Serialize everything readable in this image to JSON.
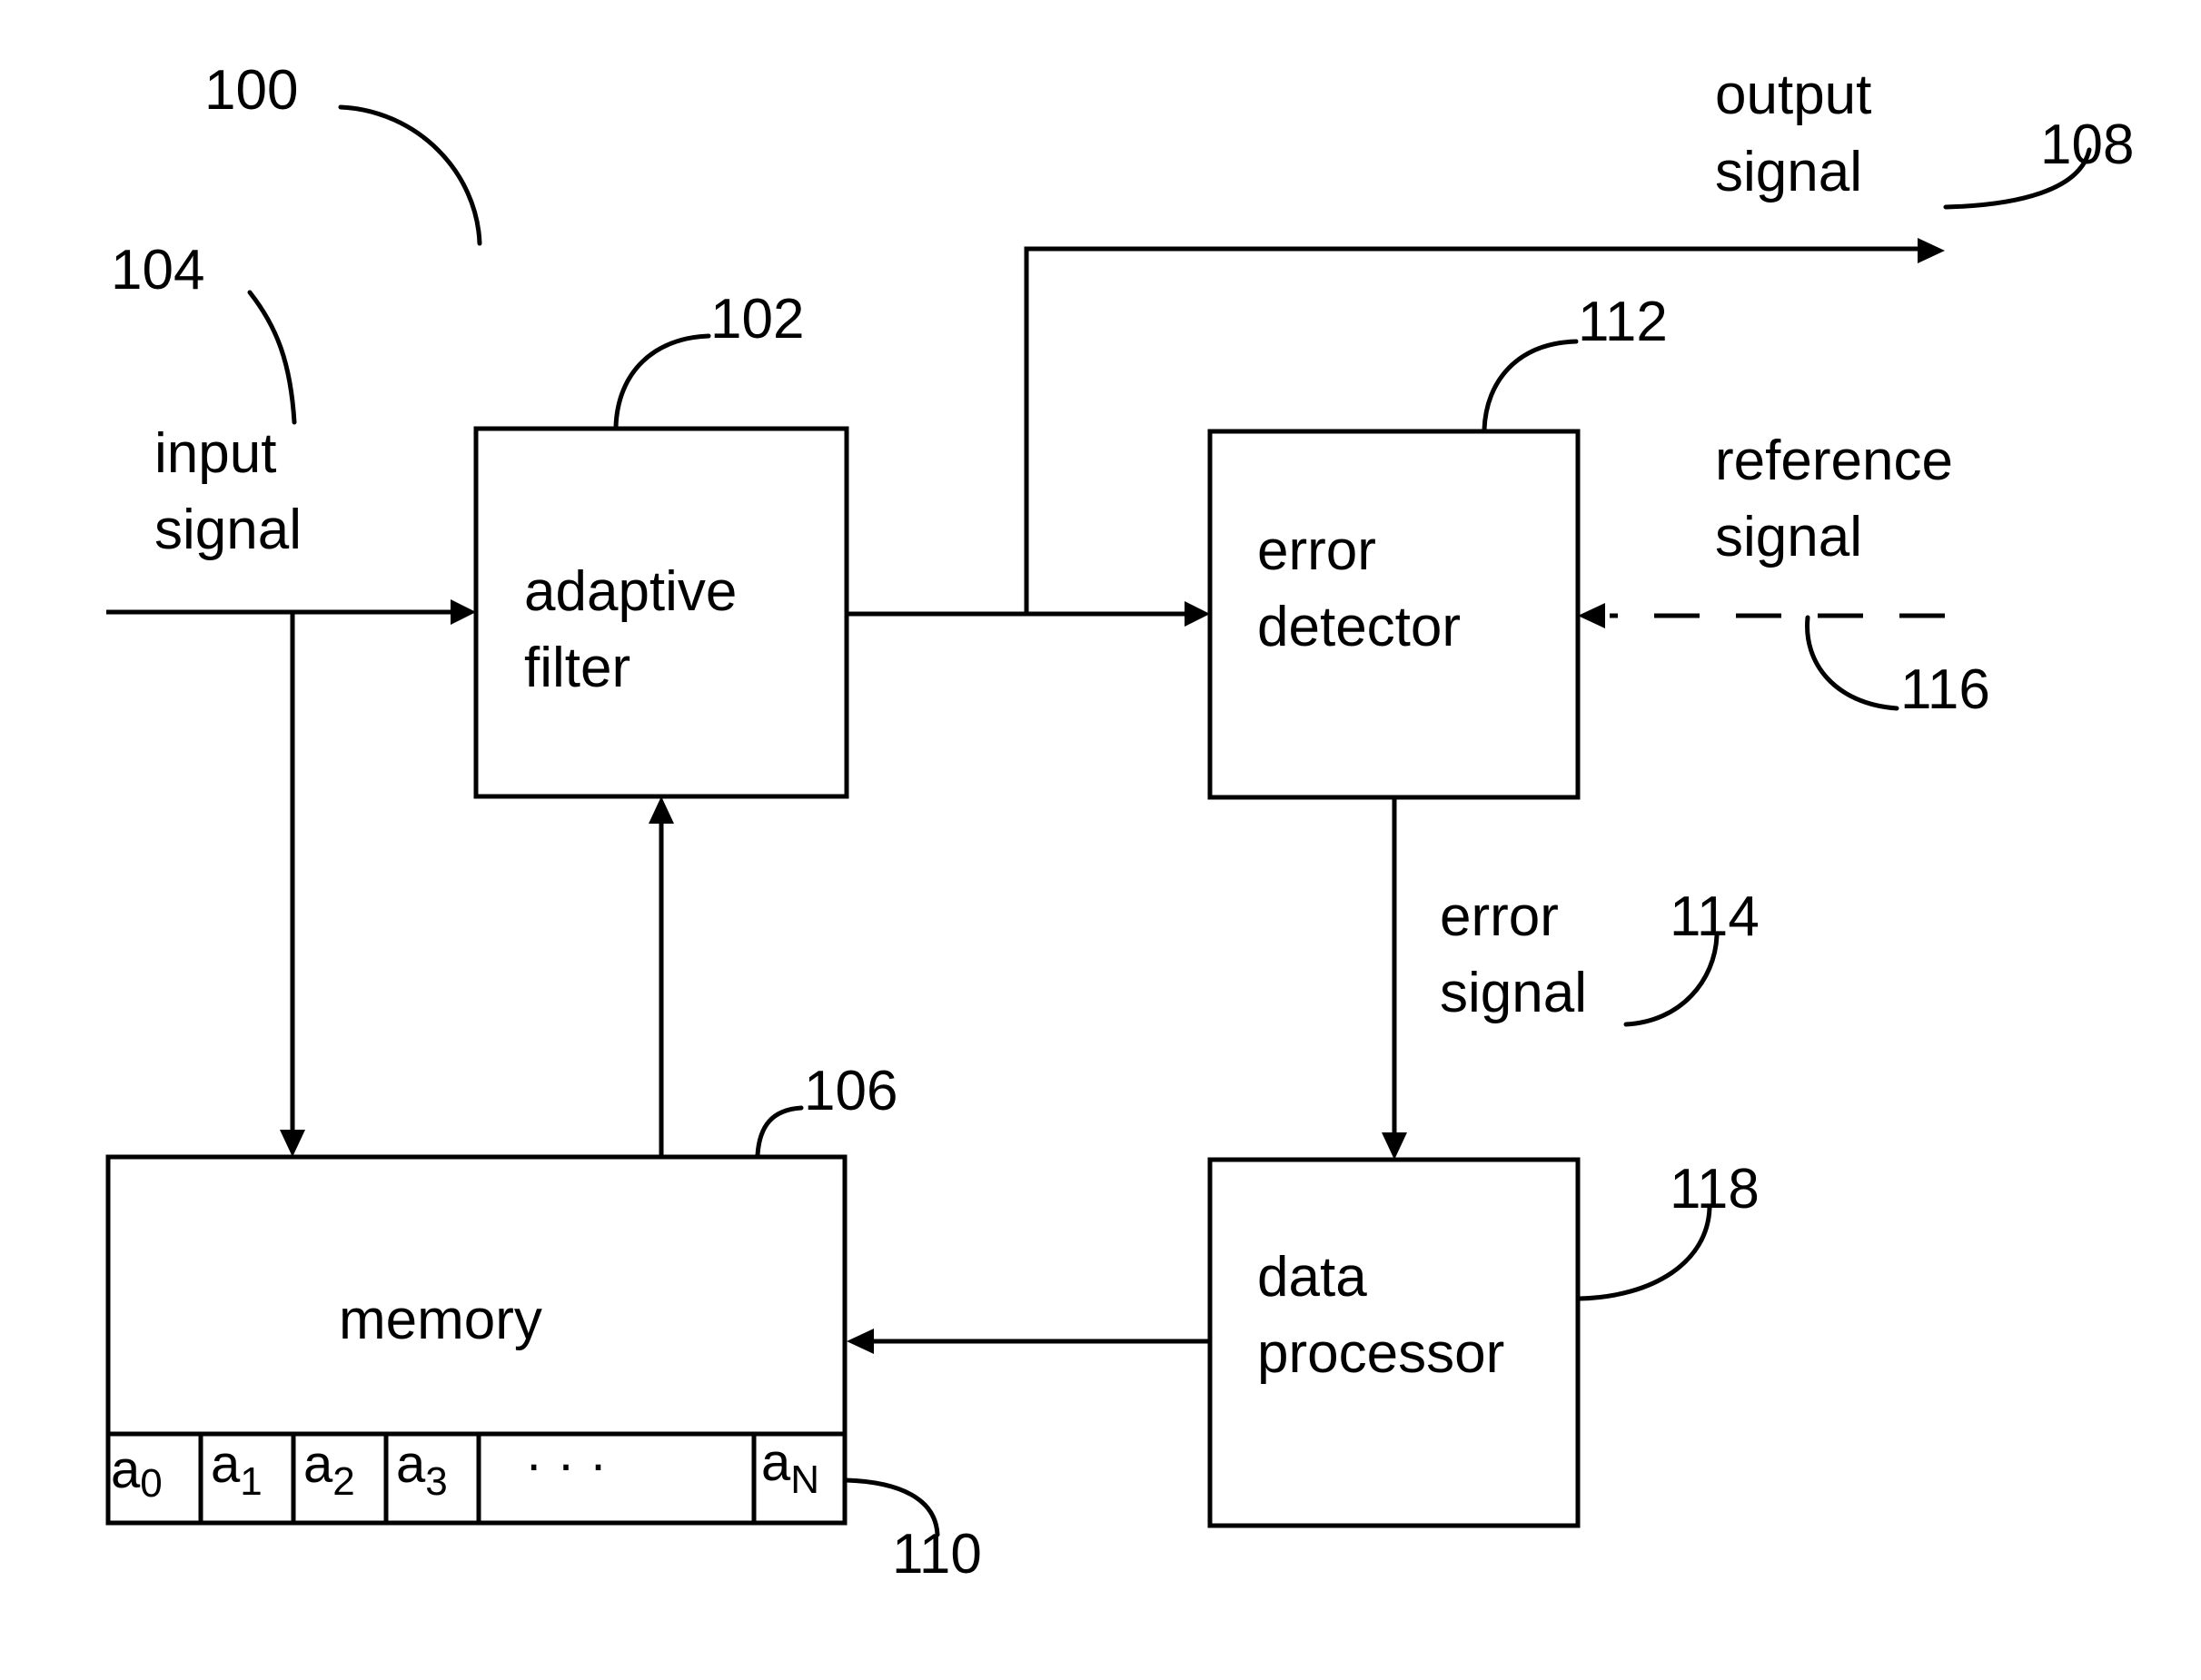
{
  "figure": {
    "system_ref": "100",
    "blocks": {
      "adaptive_filter": {
        "ref": "102",
        "lines": [
          "adaptive",
          "filter"
        ]
      },
      "error_detector": {
        "ref": "112",
        "lines": [
          "error",
          "detector"
        ]
      },
      "memory": {
        "ref": "106",
        "label": "memory"
      },
      "data_processor": {
        "ref": "118",
        "lines": [
          "data",
          "processor"
        ]
      }
    },
    "coefficients": {
      "ref": "110",
      "cells": [
        {
          "base": "a",
          "sub": "0"
        },
        {
          "base": "a",
          "sub": "1"
        },
        {
          "base": "a",
          "sub": "2"
        },
        {
          "base": "a",
          "sub": "3"
        },
        {
          "base": "",
          "sub": "",
          "text": "· · ·"
        },
        {
          "base": "a",
          "sub": "N"
        }
      ]
    },
    "signals": {
      "input": {
        "ref": "104",
        "lines": [
          "input",
          "signal"
        ]
      },
      "output": {
        "ref": "108",
        "lines": [
          "output",
          "signal"
        ]
      },
      "reference": {
        "ref": "116",
        "lines": [
          "reference",
          "signal"
        ]
      },
      "error": {
        "ref": "114",
        "lines": [
          "error",
          "signal"
        ]
      }
    }
  }
}
